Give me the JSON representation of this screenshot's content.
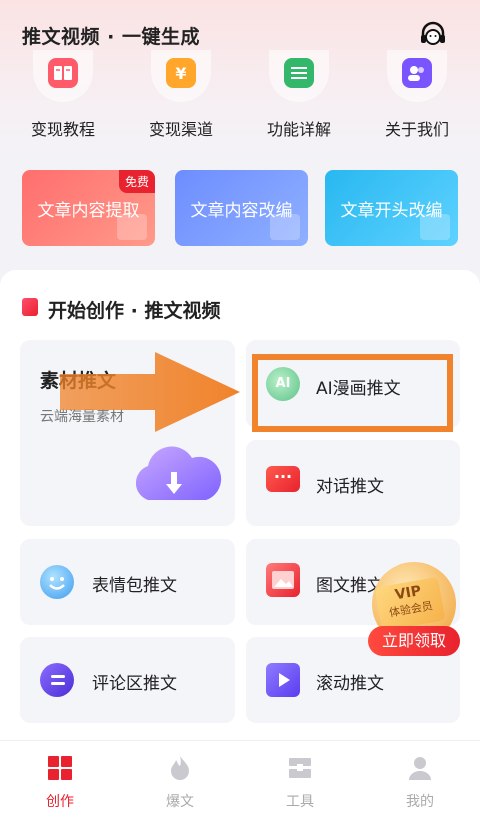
{
  "header": {
    "title": "推文视频 · 一键生成"
  },
  "quick_links": [
    {
      "label": "变现教程",
      "icon": "book-icon",
      "color": "#ff5a6a"
    },
    {
      "label": "变现渠道",
      "icon": "yen-icon",
      "color": "#ffa62b"
    },
    {
      "label": "功能详解",
      "icon": "list-icon",
      "color": "#33b86b"
    },
    {
      "label": "关于我们",
      "icon": "people-icon",
      "color": "#7a55ff"
    }
  ],
  "features": [
    {
      "label": "文章内容提取",
      "badge": "免费"
    },
    {
      "label": "文章内容改编"
    },
    {
      "label": "文章开头改编"
    }
  ],
  "create": {
    "section_title": "开始创作 · 推文视频",
    "material": {
      "title": "素材推文",
      "subtitle": "云端海量素材"
    },
    "ai_comic": {
      "label": "AI漫画推文",
      "icon_text": "AI"
    },
    "dialog": {
      "label": "对话推文"
    },
    "emoji": {
      "label": "表情包推文"
    },
    "image_text": {
      "label": "图文推文"
    },
    "comment": {
      "label": "评论区推文"
    },
    "scroll": {
      "label": "滚动推文"
    }
  },
  "vip_promo": {
    "title": "VIP",
    "subtitle": "体验会员",
    "cta": "立即领取"
  },
  "tabbar": [
    {
      "label": "创作",
      "active": true
    },
    {
      "label": "爆文",
      "active": false
    },
    {
      "label": "工具",
      "active": false
    },
    {
      "label": "我的",
      "active": false
    }
  ],
  "colors": {
    "accent": "#e8222e",
    "highlight": "#f0832b"
  }
}
